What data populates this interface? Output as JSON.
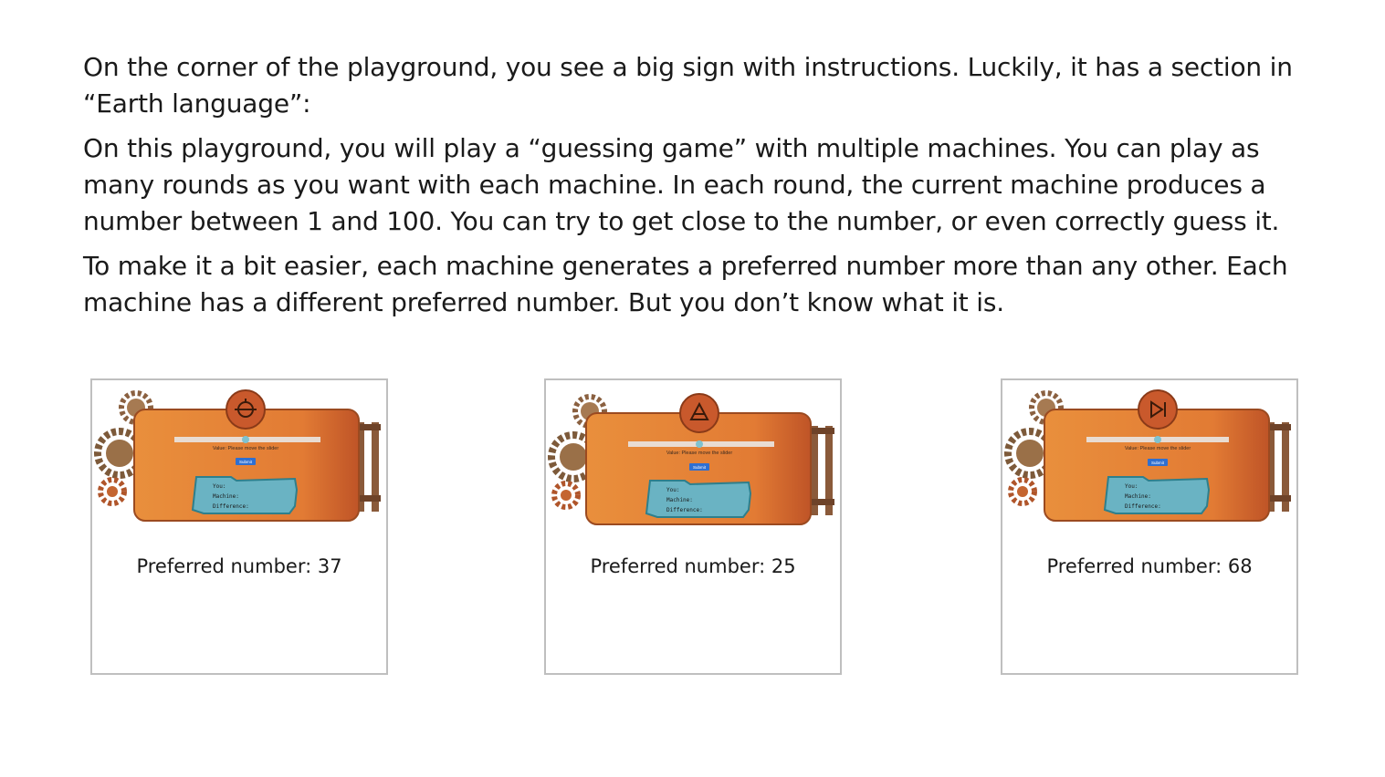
{
  "instructions": {
    "p1": "On the corner of the playground, you see a big sign with instructions. Luckily, it has a section in “Earth language”:",
    "p2": "On this playground, you will play a “guessing game” with multiple machines. You can play as many rounds as you want with each machine. In each round, the current machine produces a number between 1 and 100. You can try to get close to the number, or even correctly guess it.",
    "p3": "To make it a bit easier, each machine generates a preferred number more than any other. Each machine has a different preferred number. But you don’t know what it is."
  },
  "machines": [
    {
      "symbol_icon": "circle-theta-icon",
      "value_text": "Value: Please move the slider",
      "submit_label": "Submit",
      "you_label": "You:",
      "machine_label": "Machine:",
      "difference_label": "Difference:",
      "caption": "Preferred number: 37"
    },
    {
      "symbol_icon": "triangle-icon",
      "value_text": "Value: Please move the slider",
      "submit_label": "Submit",
      "you_label": "You:",
      "machine_label": "Machine:",
      "difference_label": "Difference:",
      "caption": "Preferred number: 25"
    },
    {
      "symbol_icon": "play-to-end-icon",
      "value_text": "Value: Please move the slider",
      "submit_label": "Submit",
      "you_label": "You:",
      "machine_label": "Machine:",
      "difference_label": "Difference:",
      "caption": "Preferred number: 68"
    }
  ],
  "colors": {
    "panel_orange": "#e58a3a",
    "panel_dark": "#c45a25",
    "screen_blue": "#6ab3c3",
    "button_blue": "#2f6fd0",
    "slider_track": "#e6d9cf",
    "gear": "#8a6040"
  }
}
